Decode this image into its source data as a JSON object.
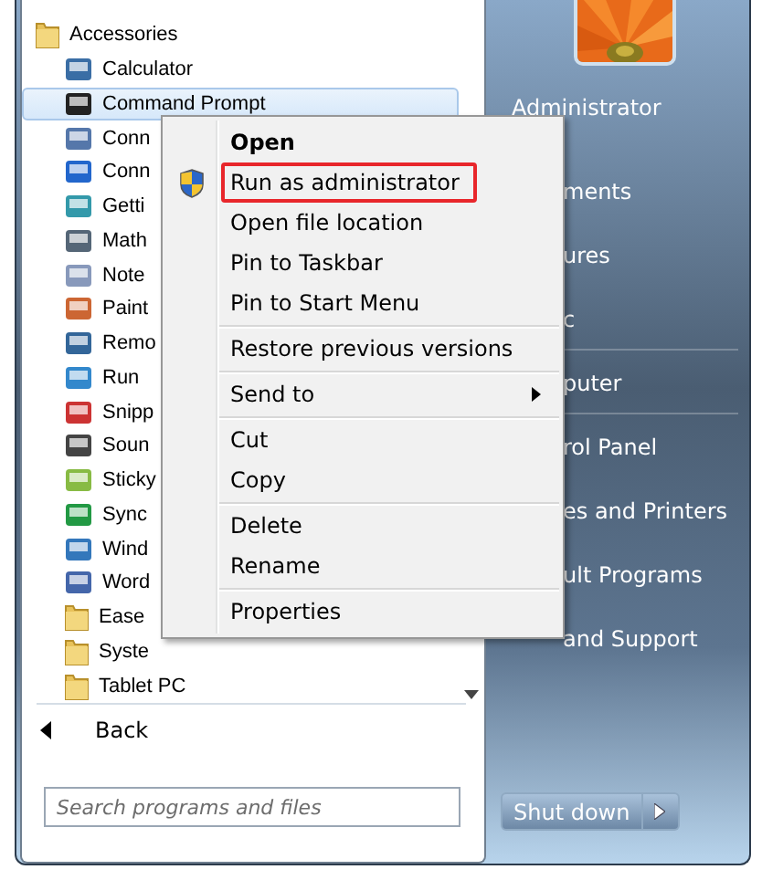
{
  "programs": [
    {
      "label": "Accessories",
      "kind": "folder",
      "selected": false,
      "children": [
        {
          "label": "Calculator",
          "kind": "program",
          "selected": false
        },
        {
          "label": "Command Prompt",
          "kind": "program",
          "selected": true
        },
        {
          "label": "Conn",
          "kind": "program",
          "selected": false
        },
        {
          "label": "Conn",
          "kind": "program",
          "selected": false
        },
        {
          "label": "Getti",
          "kind": "program",
          "selected": false
        },
        {
          "label": "Math",
          "kind": "program",
          "selected": false
        },
        {
          "label": "Note",
          "kind": "program",
          "selected": false
        },
        {
          "label": "Paint",
          "kind": "program",
          "selected": false
        },
        {
          "label": "Remo",
          "kind": "program",
          "selected": false
        },
        {
          "label": "Run",
          "kind": "program",
          "selected": false
        },
        {
          "label": "Snipp",
          "kind": "program",
          "selected": false
        },
        {
          "label": "Soun",
          "kind": "program",
          "selected": false
        },
        {
          "label": "Sticky",
          "kind": "program",
          "selected": false
        },
        {
          "label": "Sync",
          "kind": "program",
          "selected": false
        },
        {
          "label": "Wind",
          "kind": "program",
          "selected": false
        },
        {
          "label": "Word",
          "kind": "program",
          "selected": false
        },
        {
          "label": "Ease",
          "kind": "folder",
          "selected": false
        },
        {
          "label": "Syste",
          "kind": "folder",
          "selected": false
        },
        {
          "label": "Tablet PC",
          "kind": "folder",
          "selected": false
        }
      ]
    }
  ],
  "back": {
    "label": "Back"
  },
  "search": {
    "placeholder": "Search programs and files"
  },
  "user": {
    "name": "Administrator"
  },
  "right_items": [
    {
      "label": "ments",
      "separator_after": false
    },
    {
      "label": "ures",
      "separator_after": false
    },
    {
      "label": "c",
      "separator_after": true
    },
    {
      "label": "puter",
      "separator_after": true
    },
    {
      "label": "rol Panel",
      "separator_after": false
    },
    {
      "label": "es and Printers",
      "separator_after": false
    },
    {
      "label": "ult Programs",
      "separator_after": false
    },
    {
      "label": "and Support",
      "separator_after": false
    }
  ],
  "shutdown": {
    "label": "Shut down"
  },
  "context_menu": [
    [
      {
        "label": "Open",
        "default": true,
        "highlighted": false,
        "shield": false,
        "submenu": false
      },
      {
        "label": "Run as administrator",
        "default": false,
        "highlighted": true,
        "shield": true,
        "submenu": false
      },
      {
        "label": "Open file location",
        "default": false,
        "highlighted": false,
        "shield": false,
        "submenu": false
      },
      {
        "label": "Pin to Taskbar",
        "default": false,
        "highlighted": false,
        "shield": false,
        "submenu": false
      },
      {
        "label": "Pin to Start Menu",
        "default": false,
        "highlighted": false,
        "shield": false,
        "submenu": false
      }
    ],
    [
      {
        "label": "Restore previous versions",
        "default": false,
        "highlighted": false,
        "shield": false,
        "submenu": false
      }
    ],
    [
      {
        "label": "Send to",
        "default": false,
        "highlighted": false,
        "shield": false,
        "submenu": true
      }
    ],
    [
      {
        "label": "Cut",
        "default": false,
        "highlighted": false,
        "shield": false,
        "submenu": false
      },
      {
        "label": "Copy",
        "default": false,
        "highlighted": false,
        "shield": false,
        "submenu": false
      }
    ],
    [
      {
        "label": "Delete",
        "default": false,
        "highlighted": false,
        "shield": false,
        "submenu": false
      },
      {
        "label": "Rename",
        "default": false,
        "highlighted": false,
        "shield": false,
        "submenu": false
      }
    ],
    [
      {
        "label": "Properties",
        "default": false,
        "highlighted": false,
        "shield": false,
        "submenu": false
      }
    ]
  ]
}
